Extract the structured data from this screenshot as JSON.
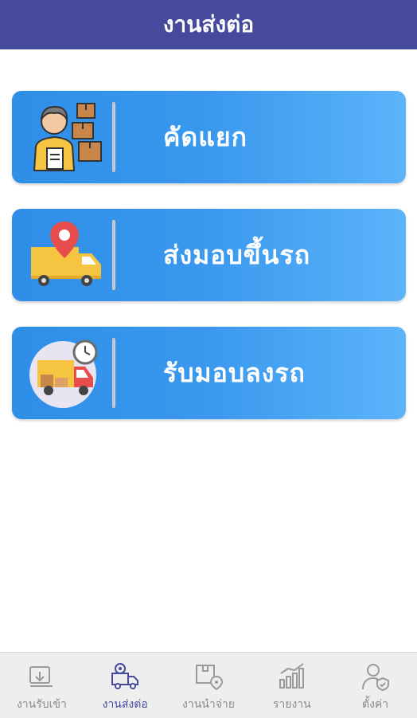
{
  "header": {
    "title": "งานส่งต่อ"
  },
  "menu": [
    {
      "label": "คัดแยก",
      "icon": "worker-with-boxes-icon"
    },
    {
      "label": "ส่งมอบขึ้นรถ",
      "icon": "delivery-truck-pin-icon"
    },
    {
      "label": "รับมอบลงรถ",
      "icon": "truck-clock-icon"
    }
  ],
  "bottom_nav": {
    "items": [
      {
        "label": "งานรับเข้า",
        "icon": "receive-icon",
        "active": false
      },
      {
        "label": "งานส่งต่อ",
        "icon": "transfer-truck-icon",
        "active": true
      },
      {
        "label": "งานนำจ่าย",
        "icon": "box-location-icon",
        "active": false
      },
      {
        "label": "รายงาน",
        "icon": "report-chart-icon",
        "active": false
      },
      {
        "label": "ตั้งค่า",
        "icon": "user-settings-icon",
        "active": false
      }
    ]
  },
  "colors": {
    "header_bg": "#454a9d",
    "card_gradient_start": "#2e8ee8",
    "card_gradient_end": "#5cb4fa",
    "nav_active": "#454a9d",
    "nav_inactive": "#8a8a8a"
  }
}
